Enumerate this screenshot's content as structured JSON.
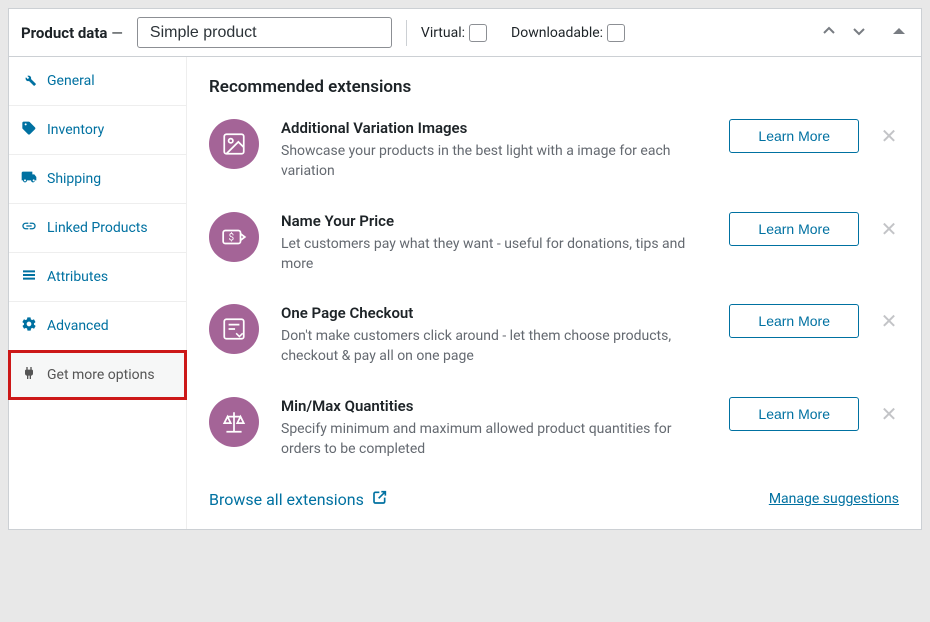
{
  "header": {
    "title": "Product data",
    "dash": "—",
    "product_type": "Simple product",
    "virtual_label": "Virtual:",
    "downloadable_label": "Downloadable:"
  },
  "tabs": {
    "general": "General",
    "inventory": "Inventory",
    "shipping": "Shipping",
    "linked": "Linked Products",
    "attributes": "Attributes",
    "advanced": "Advanced",
    "get_more": "Get more options"
  },
  "content": {
    "heading": "Recommended extensions",
    "extensions": [
      {
        "title": "Additional Variation Images",
        "desc": "Showcase your products in the best light with a image for each variation",
        "button": "Learn More"
      },
      {
        "title": "Name Your Price",
        "desc": "Let customers pay what they want - useful for donations, tips and more",
        "button": "Learn More"
      },
      {
        "title": "One Page Checkout",
        "desc": "Don't make customers click around - let them choose products, checkout & pay all on one page",
        "button": "Learn More"
      },
      {
        "title": "Min/Max Quantities",
        "desc": "Specify minimum and maximum allowed product quantities for orders to be completed",
        "button": "Learn More"
      }
    ],
    "browse": "Browse all extensions",
    "manage": "Manage suggestions"
  }
}
